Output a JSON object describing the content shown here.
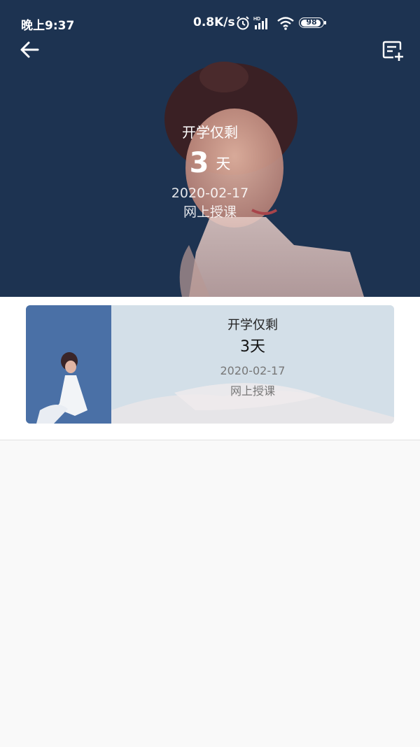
{
  "status_bar": {
    "time": "晚上9:37",
    "net_speed": "0.8K/s",
    "battery": "98",
    "icons": [
      "alarm-icon",
      "hd-signal-icon",
      "wifi-icon",
      "battery-icon"
    ]
  },
  "toolbar": {
    "back_icon": "arrow-left-icon",
    "add_icon": "add-note-icon"
  },
  "hero": {
    "label": "开学仅剩",
    "count": "3",
    "unit": "天",
    "date": "2020-02-17",
    "type": "网上授课"
  },
  "events": [
    {
      "label": "开学仅剩",
      "count_text": "3天",
      "date": "2020-02-17",
      "type": "网上授课"
    }
  ],
  "colors": {
    "hero_bg": "#1d3351",
    "card_bg": "#d3dfe8",
    "thumb_bg": "#4a70a6"
  }
}
